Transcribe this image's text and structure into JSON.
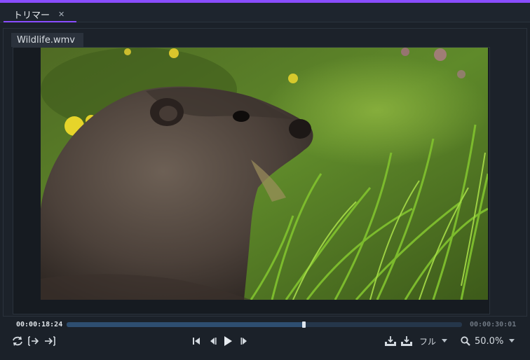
{
  "tab": {
    "label": "トリマー",
    "close_glyph": "✕"
  },
  "file": {
    "name": "Wildlife.wmv"
  },
  "video": {
    "description_icon": "video-frame-icon"
  },
  "timeline": {
    "current_time": "00:00:18:24",
    "total_time": "00:00:30:01",
    "progress": 0.6
  },
  "controls": {
    "left": [
      "loop-icon",
      "mark-in-icon",
      "mark-out-icon"
    ],
    "center": [
      "skip-to-start-icon",
      "prev-frame-icon",
      "play-icon",
      "next-frame-icon"
    ],
    "quality_label": "フル",
    "zoom_value": "50.0%"
  },
  "colors": {
    "accent": "#8a4dff",
    "background": "#1b2129",
    "track": "#25364a",
    "text": "#c9d0d8"
  }
}
